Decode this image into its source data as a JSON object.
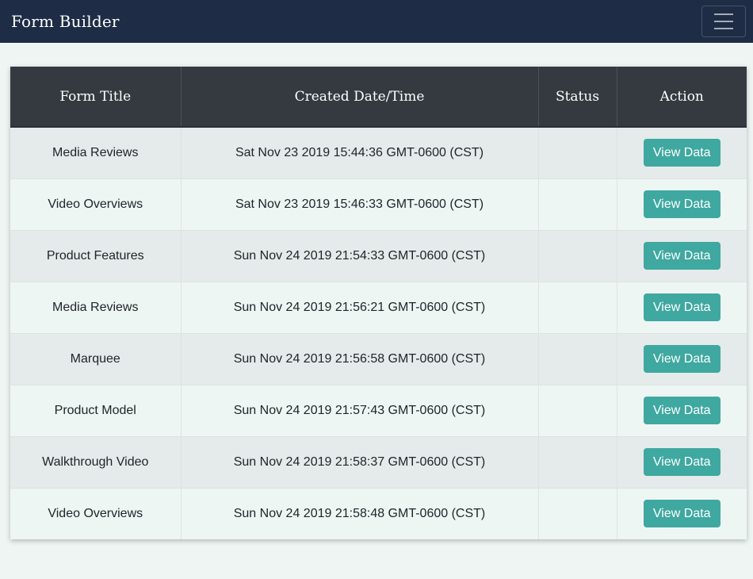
{
  "navbar": {
    "brand": "Form Builder",
    "toggle_icon": "hamburger-menu-icon"
  },
  "table": {
    "headers": {
      "title": "Form Title",
      "created": "Created Date/Time",
      "status": "Status",
      "action": "Action"
    },
    "rows": [
      {
        "title": "Media Reviews",
        "created": "Sat Nov 23 2019 15:44:36 GMT-0600 (CST)",
        "status": "",
        "action": "View Data"
      },
      {
        "title": "Video Overviews",
        "created": "Sat Nov 23 2019 15:46:33 GMT-0600 (CST)",
        "status": "",
        "action": "View Data"
      },
      {
        "title": "Product Features",
        "created": "Sun Nov 24 2019 21:54:33 GMT-0600 (CST)",
        "status": "",
        "action": "View Data"
      },
      {
        "title": "Media Reviews",
        "created": "Sun Nov 24 2019 21:56:21 GMT-0600 (CST)",
        "status": "",
        "action": "View Data"
      },
      {
        "title": "Marquee",
        "created": "Sun Nov 24 2019 21:56:58 GMT-0600 (CST)",
        "status": "",
        "action": "View Data"
      },
      {
        "title": "Product Model",
        "created": "Sun Nov 24 2019 21:57:43 GMT-0600 (CST)",
        "status": "",
        "action": "View Data"
      },
      {
        "title": "Walkthrough Video",
        "created": "Sun Nov 24 2019 21:58:37 GMT-0600 (CST)",
        "status": "",
        "action": "View Data"
      },
      {
        "title": "Video Overviews",
        "created": "Sun Nov 24 2019 21:58:48 GMT-0600 (CST)",
        "status": "",
        "action": "View Data"
      }
    ]
  },
  "colors": {
    "navbar_bg": "#1e2d45",
    "table_header_bg": "#343a40",
    "button_bg": "#3fa8a0",
    "page_bg": "#eef5f3"
  }
}
